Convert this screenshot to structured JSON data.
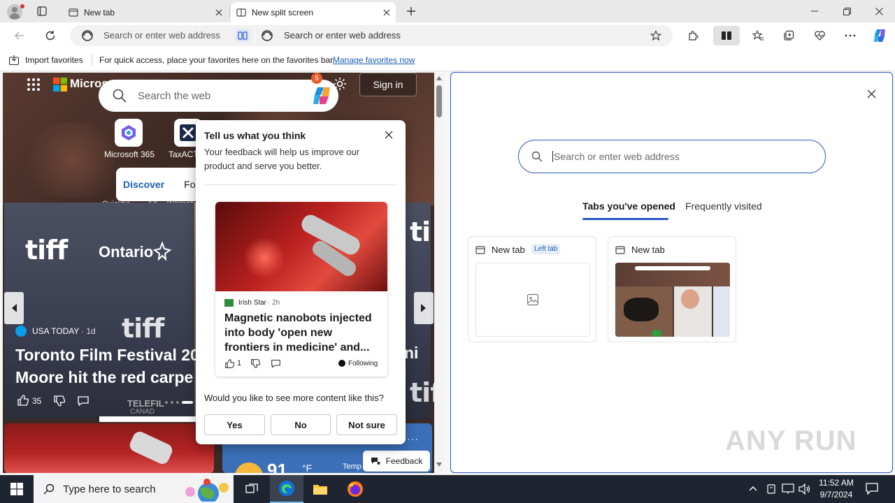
{
  "browser": {
    "tabs": [
      {
        "title": "New tab",
        "active": false
      },
      {
        "title": "New split screen",
        "active": true
      }
    ],
    "address_left": {
      "placeholder": "Search or enter web address"
    },
    "address_right": {
      "placeholder": "Search or enter web address"
    },
    "favorites_bar": {
      "import_label": "Import favorites",
      "message": "For quick access, place your favorites here on the favorites bar.",
      "manage_link": "Manage favorites now"
    }
  },
  "left_pane": {
    "brand": "Micros",
    "search_placeholder": "Search the web",
    "copilot_badge": "5",
    "sign_in": "Sign in",
    "apps": [
      {
        "label": "Microsoft 365",
        "icon": "microsoft-365-icon"
      },
      {
        "label": "TaxACT",
        "icon": "taxact-icon"
      }
    ],
    "discover_tabs": [
      "Discover",
      "Follo"
    ],
    "small_links": [
      "Quickbo...",
      "Ad",
      "Walmsh"
    ],
    "hero": {
      "source": "USA TODAY",
      "age": "· 1d",
      "title_line1": "Toronto Film Festival 20",
      "title_line2": "Moore hit the red carpe",
      "title_suffix": "ni",
      "likes": "35",
      "banner_words": [
        "tiff",
        "Ontario",
        "tiff",
        "ti",
        "tiff",
        "TELEFIL",
        "CANAD"
      ]
    },
    "weather": {
      "temp": "91",
      "unit": "°F",
      "label": "Temp"
    },
    "feedback_button": "Feedback"
  },
  "popup": {
    "title": "Tell us what you think",
    "subtitle": "Your feedback will help us improve our product and serve you better.",
    "card": {
      "source": "Irish Star",
      "age": "· 2h",
      "headline": "Magnetic nanobots injected into body 'open new frontiers in medicine' and...",
      "likes": "1",
      "following": "Following"
    },
    "question": "Would you like to see more content like this?",
    "buttons": [
      "Yes",
      "No",
      "Not sure"
    ]
  },
  "right_pane": {
    "search_placeholder": "Search or enter web address",
    "tabs": [
      "Tabs you've opened",
      "Frequently visited"
    ],
    "cards": [
      {
        "title": "New tab",
        "badge": "Left tab"
      },
      {
        "title": "New tab",
        "badge": ""
      }
    ],
    "watermark": "ANY RUN"
  },
  "taskbar": {
    "search_placeholder": "Type here to search",
    "time": "11:52 AM",
    "date": "9/7/2024"
  },
  "colors": {
    "accent": "#2b57c7",
    "link": "#1a5fb4",
    "taskbar": "#1f2530"
  }
}
